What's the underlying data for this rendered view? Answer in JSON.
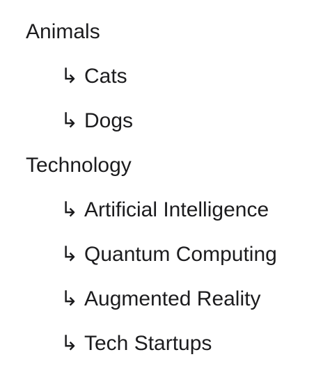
{
  "tree": [
    {
      "label": "Animals",
      "children": [
        {
          "label": "Cats"
        },
        {
          "label": "Dogs"
        }
      ]
    },
    {
      "label": "Technology",
      "children": [
        {
          "label": "Artificial Intelligence"
        },
        {
          "label": "Quantum Computing"
        },
        {
          "label": "Augmented Reality"
        },
        {
          "label": "Tech Startups"
        }
      ]
    }
  ],
  "icons": {
    "child_arrow": "↳"
  }
}
